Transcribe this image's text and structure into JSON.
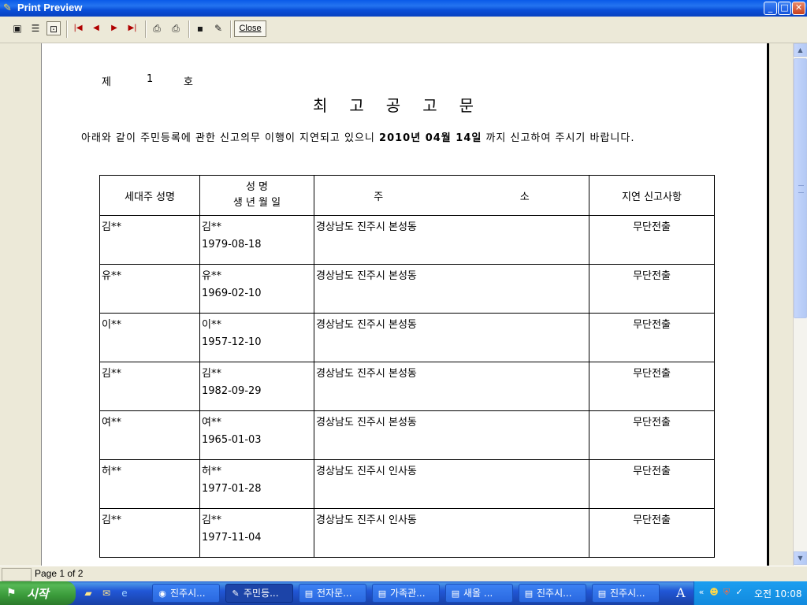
{
  "window": {
    "title": "Print Preview",
    "buttons": {
      "minimize": "_",
      "maximize": "□",
      "close": "✕"
    }
  },
  "toolbar": {
    "close_label": "Close",
    "icons": [
      "one-page-icon",
      "multi-page-icon",
      "zoom-page-icon",
      "first-page-icon",
      "prev-page-icon",
      "next-page-icon",
      "last-page-icon",
      "print-setup-icon",
      "print-icon",
      "save-icon",
      "open-icon"
    ]
  },
  "document": {
    "number_prefix": "제",
    "number_value": "1",
    "number_suffix": "호",
    "title": "최고공고문",
    "intro_before": "아래와 같이 주민등록에 관한 신고의무 이행이 지연되고 있으니 ",
    "intro_date": "2010년 04월 14일",
    "intro_after": " 까지 신고하여 주시기 바랍니다.",
    "headers": {
      "col1": "세대주 성명",
      "col2_line1": "성          명",
      "col2_line2": "생 년 월 일",
      "col3": "주                                          소",
      "col4": "지연 신고사항"
    },
    "rows": [
      {
        "head": "김**",
        "name": "김**",
        "dob": "1979-08-18",
        "address": "경상남도 진주시 본성동",
        "status": "무단전출"
      },
      {
        "head": "유**",
        "name": "유**",
        "dob": "1969-02-10",
        "address": "경상남도 진주시 본성동",
        "status": "무단전출"
      },
      {
        "head": "이**",
        "name": "이**",
        "dob": "1957-12-10",
        "address": "경상남도 진주시 본성동",
        "status": "무단전출"
      },
      {
        "head": "김**",
        "name": "김**",
        "dob": "1982-09-29",
        "address": "경상남도 진주시 본성동",
        "status": "무단전출"
      },
      {
        "head": "여**",
        "name": "여**",
        "dob": "1965-01-03",
        "address": "경상남도 진주시 본성동",
        "status": "무단전출"
      },
      {
        "head": "허**",
        "name": "허**",
        "dob": "1977-01-28",
        "address": "경상남도 진주시 인사동",
        "status": "무단전출"
      },
      {
        "head": "김**",
        "name": "김**",
        "dob": "1977-11-04",
        "address": "경상남도 진주시 인사동",
        "status": "무단전출"
      }
    ]
  },
  "statusbar": {
    "page": "Page 1 of 2"
  },
  "taskbar": {
    "start_label": "시작",
    "tasks": [
      "진주시...",
      "주민등...",
      "전자문...",
      "가족관...",
      "새올 ...",
      "진주시...",
      "진주시..."
    ],
    "ime": "A",
    "clock": "오전 10:08"
  }
}
